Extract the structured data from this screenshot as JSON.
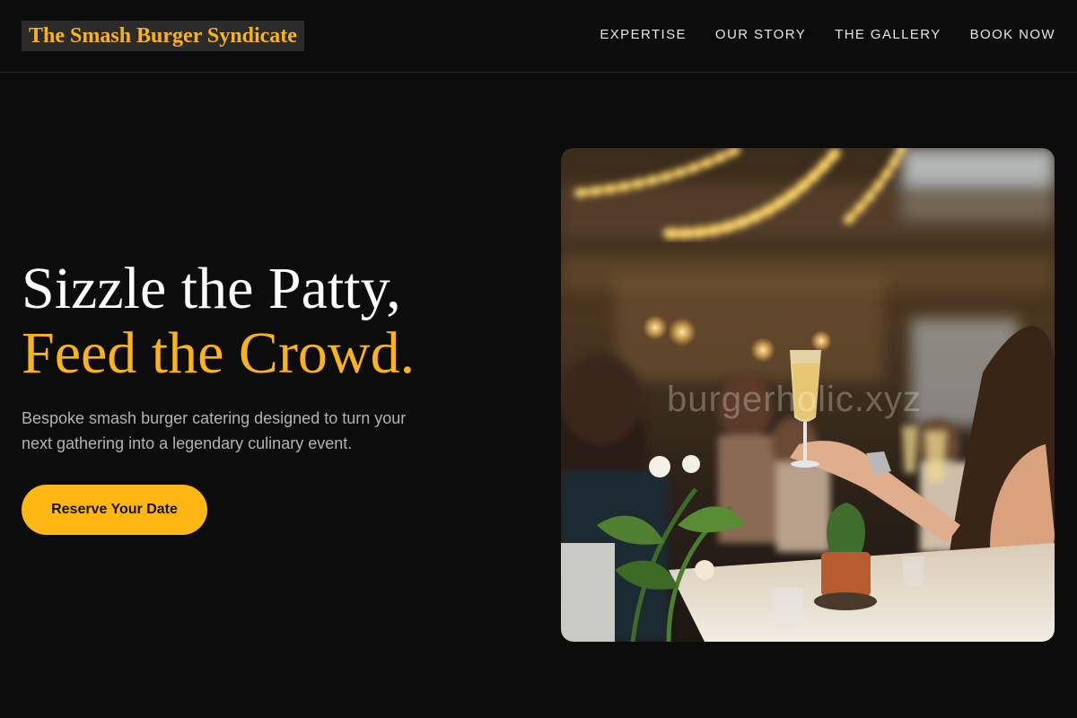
{
  "header": {
    "brand": "The Smash Burger Syndicate",
    "nav": [
      "EXPERTISE",
      "OUR STORY",
      "THE GALLERY",
      "BOOK NOW"
    ]
  },
  "hero": {
    "title_line1": "Sizzle the Patty,",
    "title_line2": "Feed the Crowd.",
    "subtitle": "Bespoke smash burger catering designed to turn your next gathering into a legendary culinary event.",
    "cta": "Reserve Your Date"
  },
  "photo": {
    "watermark": "burgerholic.xyz",
    "alt": "Guests raising champagne glasses at a banquet table under string lights"
  },
  "colors": {
    "background": "#0c0c0c",
    "accent": "#fbb318",
    "button": "#fdb713",
    "text": "#ffffff",
    "muted": "#b3b3b3"
  }
}
